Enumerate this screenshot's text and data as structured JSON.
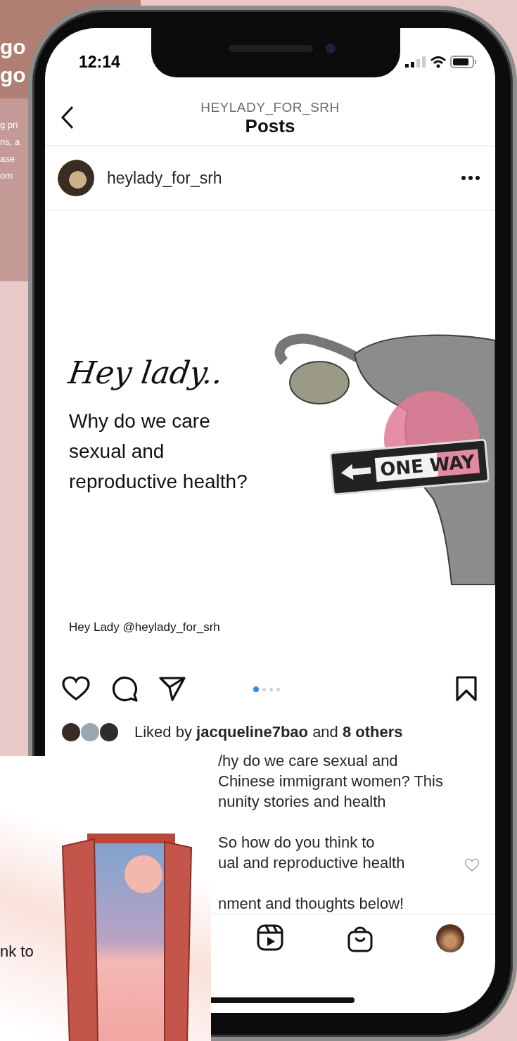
{
  "background_card": {
    "heading_lines": [
      "go",
      "go"
    ],
    "body_lines": [
      "g pri",
      "ns, a",
      "ase",
      "om"
    ]
  },
  "status_bar": {
    "time": "12:14"
  },
  "header": {
    "account": "HEYLADY_FOR_SRH",
    "title": "Posts"
  },
  "post": {
    "username": "heylady_for_srh",
    "image": {
      "script_title": "Hey lady..",
      "headline_lines": [
        "Why do we care",
        "sexual and",
        "reproductive health?"
      ],
      "sign_text": "ONE WAY",
      "credit": "Hey Lady @heylady_for_srh"
    },
    "carousel_dots": [
      {
        "selected": true
      },
      {
        "selected": false
      },
      {
        "selected": false
      },
      {
        "selected": false
      }
    ],
    "likes": "Liked by **jacqueline7bao** and **8 others**",
    "caption_paragraphs": [
      [
        "/hy do we care sexual and",
        "Chinese immigrant women? This",
        "nunity stories and health"
      ],
      [
        "So how do you think to",
        "ual and reproductive health"
      ],
      [
        "nment and thoughts below!"
      ]
    ]
  },
  "bottom_nav": [
    {
      "kind": "reels"
    },
    {
      "kind": "shop"
    },
    {
      "kind": "profile"
    }
  ],
  "front_card": {
    "text": "nk to"
  }
}
